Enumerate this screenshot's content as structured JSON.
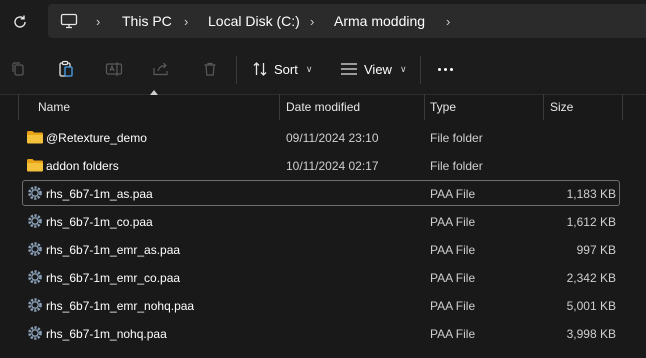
{
  "breadcrumb": [
    "This PC",
    "Local Disk (C:)",
    "Arma modding"
  ],
  "toolbar": {
    "sort_label": "Sort",
    "view_label": "View"
  },
  "columns": {
    "name": "Name",
    "date": "Date modified",
    "type": "Type",
    "size": "Size"
  },
  "files": [
    {
      "name": "@Retexture_demo",
      "date": "09/11/2024 23:10",
      "type": "File folder",
      "size": "",
      "icon": "folder-icon"
    },
    {
      "name": "addon folders",
      "date": "10/11/2024 02:17",
      "type": "File folder",
      "size": "",
      "icon": "folder-icon"
    },
    {
      "name": "rhs_6b7-1m_as.paa",
      "date": "",
      "type": "PAA File",
      "size": "1,183 KB",
      "icon": "gear-file-icon"
    },
    {
      "name": "rhs_6b7-1m_co.paa",
      "date": "",
      "type": "PAA File",
      "size": "1,612 KB",
      "icon": "gear-file-icon"
    },
    {
      "name": "rhs_6b7-1m_emr_as.paa",
      "date": "",
      "type": "PAA File",
      "size": "997 KB",
      "icon": "gear-file-icon"
    },
    {
      "name": "rhs_6b7-1m_emr_co.paa",
      "date": "",
      "type": "PAA File",
      "size": "2,342 KB",
      "icon": "gear-file-icon"
    },
    {
      "name": "rhs_6b7-1m_emr_nohq.paa",
      "date": "",
      "type": "PAA File",
      "size": "5,001 KB",
      "icon": "gear-file-icon"
    },
    {
      "name": "rhs_6b7-1m_nohq.paa",
      "date": "",
      "type": "PAA File",
      "size": "3,998 KB",
      "icon": "gear-file-icon"
    }
  ],
  "colors": {
    "folder": "#f3c13a",
    "selection_border": "#6e6e6e",
    "background": "#191919"
  }
}
